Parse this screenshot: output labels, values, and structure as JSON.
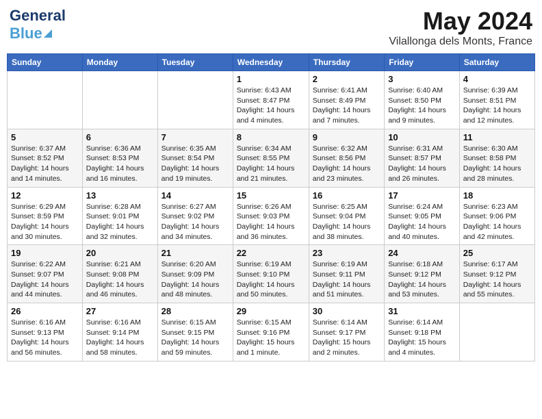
{
  "header": {
    "logo_line1": "General",
    "logo_line2": "Blue",
    "month_year": "May 2024",
    "location": "Vilallonga dels Monts, France"
  },
  "days_of_week": [
    "Sunday",
    "Monday",
    "Tuesday",
    "Wednesday",
    "Thursday",
    "Friday",
    "Saturday"
  ],
  "weeks": [
    {
      "days": [
        {
          "num": "",
          "sunrise": "",
          "sunset": "",
          "daylight": ""
        },
        {
          "num": "",
          "sunrise": "",
          "sunset": "",
          "daylight": ""
        },
        {
          "num": "",
          "sunrise": "",
          "sunset": "",
          "daylight": ""
        },
        {
          "num": "1",
          "sunrise": "Sunrise: 6:43 AM",
          "sunset": "Sunset: 8:47 PM",
          "daylight": "Daylight: 14 hours and 4 minutes."
        },
        {
          "num": "2",
          "sunrise": "Sunrise: 6:41 AM",
          "sunset": "Sunset: 8:49 PM",
          "daylight": "Daylight: 14 hours and 7 minutes."
        },
        {
          "num": "3",
          "sunrise": "Sunrise: 6:40 AM",
          "sunset": "Sunset: 8:50 PM",
          "daylight": "Daylight: 14 hours and 9 minutes."
        },
        {
          "num": "4",
          "sunrise": "Sunrise: 6:39 AM",
          "sunset": "Sunset: 8:51 PM",
          "daylight": "Daylight: 14 hours and 12 minutes."
        }
      ]
    },
    {
      "days": [
        {
          "num": "5",
          "sunrise": "Sunrise: 6:37 AM",
          "sunset": "Sunset: 8:52 PM",
          "daylight": "Daylight: 14 hours and 14 minutes."
        },
        {
          "num": "6",
          "sunrise": "Sunrise: 6:36 AM",
          "sunset": "Sunset: 8:53 PM",
          "daylight": "Daylight: 14 hours and 16 minutes."
        },
        {
          "num": "7",
          "sunrise": "Sunrise: 6:35 AM",
          "sunset": "Sunset: 8:54 PM",
          "daylight": "Daylight: 14 hours and 19 minutes."
        },
        {
          "num": "8",
          "sunrise": "Sunrise: 6:34 AM",
          "sunset": "Sunset: 8:55 PM",
          "daylight": "Daylight: 14 hours and 21 minutes."
        },
        {
          "num": "9",
          "sunrise": "Sunrise: 6:32 AM",
          "sunset": "Sunset: 8:56 PM",
          "daylight": "Daylight: 14 hours and 23 minutes."
        },
        {
          "num": "10",
          "sunrise": "Sunrise: 6:31 AM",
          "sunset": "Sunset: 8:57 PM",
          "daylight": "Daylight: 14 hours and 26 minutes."
        },
        {
          "num": "11",
          "sunrise": "Sunrise: 6:30 AM",
          "sunset": "Sunset: 8:58 PM",
          "daylight": "Daylight: 14 hours and 28 minutes."
        }
      ]
    },
    {
      "days": [
        {
          "num": "12",
          "sunrise": "Sunrise: 6:29 AM",
          "sunset": "Sunset: 8:59 PM",
          "daylight": "Daylight: 14 hours and 30 minutes."
        },
        {
          "num": "13",
          "sunrise": "Sunrise: 6:28 AM",
          "sunset": "Sunset: 9:01 PM",
          "daylight": "Daylight: 14 hours and 32 minutes."
        },
        {
          "num": "14",
          "sunrise": "Sunrise: 6:27 AM",
          "sunset": "Sunset: 9:02 PM",
          "daylight": "Daylight: 14 hours and 34 minutes."
        },
        {
          "num": "15",
          "sunrise": "Sunrise: 6:26 AM",
          "sunset": "Sunset: 9:03 PM",
          "daylight": "Daylight: 14 hours and 36 minutes."
        },
        {
          "num": "16",
          "sunrise": "Sunrise: 6:25 AM",
          "sunset": "Sunset: 9:04 PM",
          "daylight": "Daylight: 14 hours and 38 minutes."
        },
        {
          "num": "17",
          "sunrise": "Sunrise: 6:24 AM",
          "sunset": "Sunset: 9:05 PM",
          "daylight": "Daylight: 14 hours and 40 minutes."
        },
        {
          "num": "18",
          "sunrise": "Sunrise: 6:23 AM",
          "sunset": "Sunset: 9:06 PM",
          "daylight": "Daylight: 14 hours and 42 minutes."
        }
      ]
    },
    {
      "days": [
        {
          "num": "19",
          "sunrise": "Sunrise: 6:22 AM",
          "sunset": "Sunset: 9:07 PM",
          "daylight": "Daylight: 14 hours and 44 minutes."
        },
        {
          "num": "20",
          "sunrise": "Sunrise: 6:21 AM",
          "sunset": "Sunset: 9:08 PM",
          "daylight": "Daylight: 14 hours and 46 minutes."
        },
        {
          "num": "21",
          "sunrise": "Sunrise: 6:20 AM",
          "sunset": "Sunset: 9:09 PM",
          "daylight": "Daylight: 14 hours and 48 minutes."
        },
        {
          "num": "22",
          "sunrise": "Sunrise: 6:19 AM",
          "sunset": "Sunset: 9:10 PM",
          "daylight": "Daylight: 14 hours and 50 minutes."
        },
        {
          "num": "23",
          "sunrise": "Sunrise: 6:19 AM",
          "sunset": "Sunset: 9:11 PM",
          "daylight": "Daylight: 14 hours and 51 minutes."
        },
        {
          "num": "24",
          "sunrise": "Sunrise: 6:18 AM",
          "sunset": "Sunset: 9:12 PM",
          "daylight": "Daylight: 14 hours and 53 minutes."
        },
        {
          "num": "25",
          "sunrise": "Sunrise: 6:17 AM",
          "sunset": "Sunset: 9:12 PM",
          "daylight": "Daylight: 14 hours and 55 minutes."
        }
      ]
    },
    {
      "days": [
        {
          "num": "26",
          "sunrise": "Sunrise: 6:16 AM",
          "sunset": "Sunset: 9:13 PM",
          "daylight": "Daylight: 14 hours and 56 minutes."
        },
        {
          "num": "27",
          "sunrise": "Sunrise: 6:16 AM",
          "sunset": "Sunset: 9:14 PM",
          "daylight": "Daylight: 14 hours and 58 minutes."
        },
        {
          "num": "28",
          "sunrise": "Sunrise: 6:15 AM",
          "sunset": "Sunset: 9:15 PM",
          "daylight": "Daylight: 14 hours and 59 minutes."
        },
        {
          "num": "29",
          "sunrise": "Sunrise: 6:15 AM",
          "sunset": "Sunset: 9:16 PM",
          "daylight": "Daylight: 15 hours and 1 minute."
        },
        {
          "num": "30",
          "sunrise": "Sunrise: 6:14 AM",
          "sunset": "Sunset: 9:17 PM",
          "daylight": "Daylight: 15 hours and 2 minutes."
        },
        {
          "num": "31",
          "sunrise": "Sunrise: 6:14 AM",
          "sunset": "Sunset: 9:18 PM",
          "daylight": "Daylight: 15 hours and 4 minutes."
        },
        {
          "num": "",
          "sunrise": "",
          "sunset": "",
          "daylight": ""
        }
      ]
    }
  ]
}
